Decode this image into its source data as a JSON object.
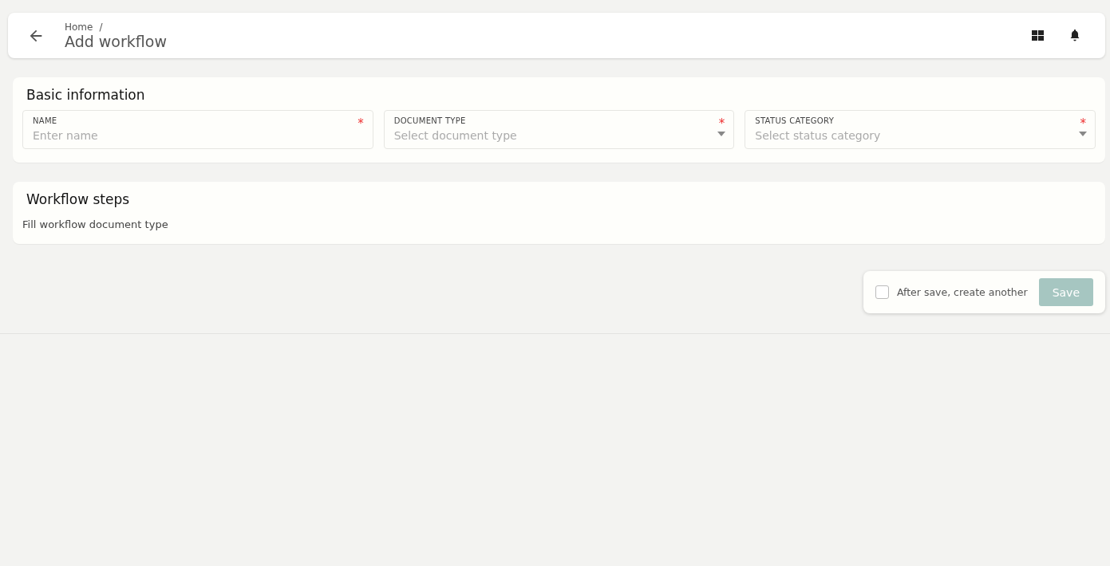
{
  "header": {
    "breadcrumb": "Home",
    "separator": "/",
    "title": "Add workflow"
  },
  "basic_information": {
    "title": "Basic information",
    "fields": [
      {
        "kind": "text",
        "label": "NAME",
        "placeholder": "Enter name",
        "required_mark": "*"
      },
      {
        "kind": "select",
        "label": "DOCUMENT TYPE",
        "placeholder": "Select document type",
        "required_mark": "*"
      },
      {
        "kind": "select",
        "label": "STATUS CATEGORY",
        "placeholder": "Select status category",
        "required_mark": "*"
      }
    ]
  },
  "workflow_steps": {
    "title": "Workflow steps",
    "message": "Fill workflow document type"
  },
  "footer": {
    "create_another": {
      "label": "After save, create another",
      "checked": false
    },
    "save": {
      "label": "Save",
      "disabled": true
    }
  }
}
